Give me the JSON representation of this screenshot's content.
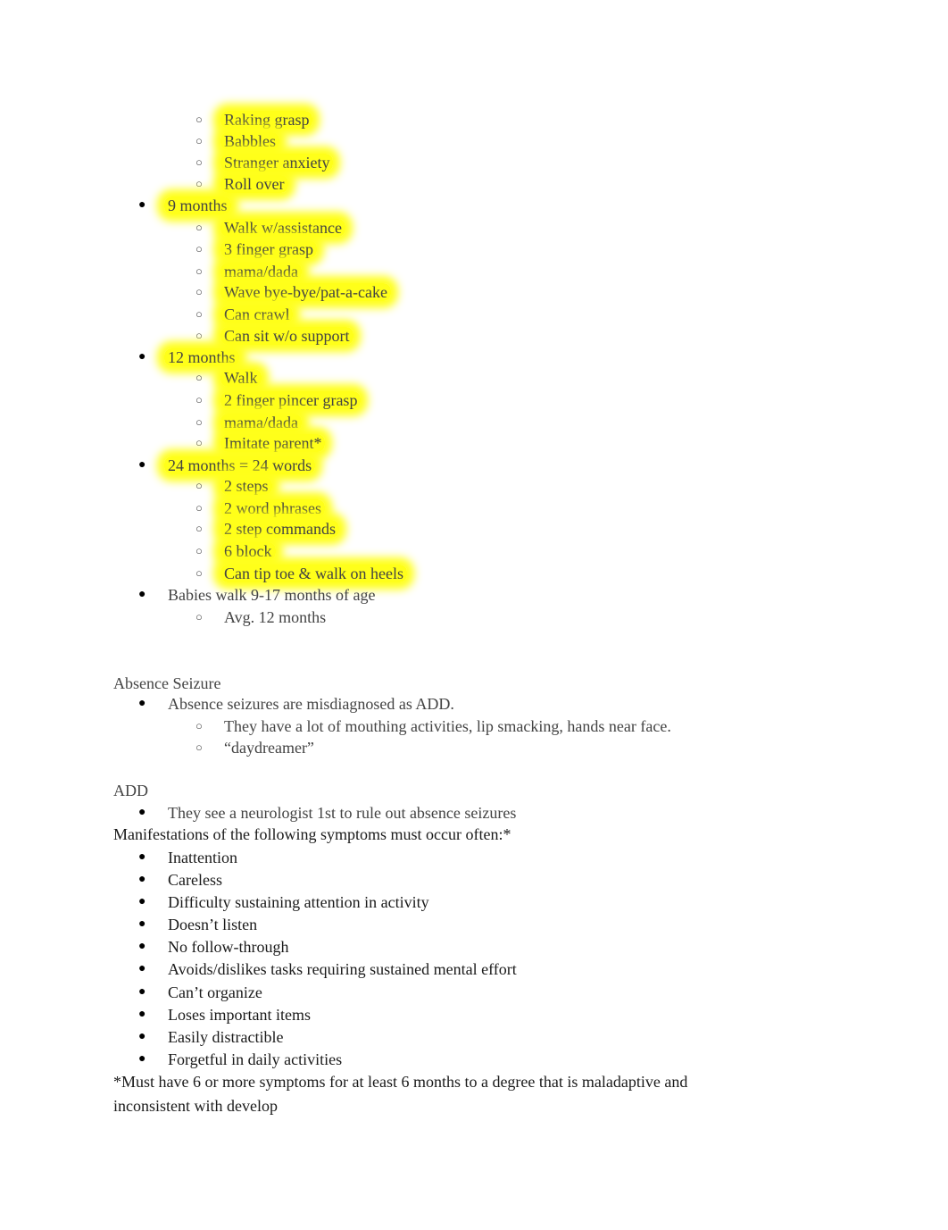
{
  "milestones": {
    "six_month_subitems": [
      {
        "label": "Raking grasp"
      },
      {
        "label": "Babbles"
      },
      {
        "label": "Stranger anxiety"
      },
      {
        "label": "Roll over"
      }
    ],
    "groups": [
      {
        "label": "9 months",
        "items": [
          "Walk w/assistance",
          "3 finger grasp",
          "mama/dada",
          "Wave bye-bye/pat-a-cake",
          "Can crawl",
          "Can sit w/o support"
        ]
      },
      {
        "label": "12 months",
        "items": [
          "Walk",
          "2 finger pincer grasp",
          "mama/dada",
          "Imitate parent*"
        ]
      },
      {
        "label": "24 months = 24 words",
        "items": [
          "2 steps",
          "2 word phrases",
          "2 step commands",
          "6 block",
          "Can tip toe & walk on heels"
        ]
      }
    ],
    "walk_note": {
      "label": "Babies walk 9-17 months of age",
      "items": [
        "Avg. 12 months"
      ]
    }
  },
  "absence_seizure": {
    "heading": "Absence Seizure",
    "bullet": "Absence seizures are misdiagnosed as ADD.",
    "subitems": [
      "They have a lot of mouthing activities, lip smacking, hands near face.",
      "“daydreamer”"
    ]
  },
  "add": {
    "heading": "ADD",
    "bullet": "They see a neurologist 1st to rule out absence seizures",
    "manifestations_intro": "Manifestations of the following symptoms must occur often:*",
    "symptoms": [
      "Inattention",
      "Careless",
      "Difficulty sustaining attention in activity",
      "Doesn’t listen",
      "No follow-through",
      "Avoids/dislikes tasks requiring sustained mental effort",
      "Can’t organize",
      "Loses important items",
      "Easily distractible",
      "Forgetful in daily activities"
    ],
    "footnote_line1": "*Must have 6 or more symptoms for at least 6 months to a degree that is maladaptive and",
    "footnote_line2": "inconsistent with develop"
  },
  "glyphs": {
    "filled_bullet": "●",
    "hollow_bullet": "○"
  },
  "colors": {
    "highlight": "#ffff1a",
    "text_gray": "#434343",
    "text_dark": "#1a1a1a"
  }
}
